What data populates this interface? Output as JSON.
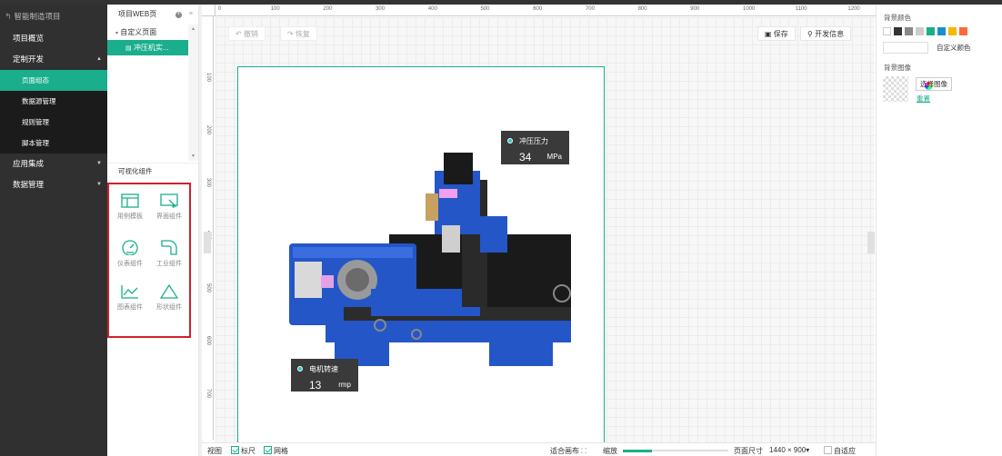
{
  "sidebar": {
    "project_title": "智能制造项目",
    "items": [
      {
        "label": "项目概览"
      },
      {
        "label": "定制开发",
        "arrow": "▲"
      },
      {
        "label": "页面组态"
      },
      {
        "label": "数据源管理"
      },
      {
        "label": "规则管理"
      },
      {
        "label": "脚本管理"
      },
      {
        "label": "应用集成",
        "arrow": "▼"
      },
      {
        "label": "数据管理",
        "arrow": "▼"
      }
    ]
  },
  "tree": {
    "header": "项目WEB页",
    "nodes": [
      {
        "label": "自定义页面",
        "icon": "caret-down-icon"
      },
      {
        "label": "冲压机实..."
      }
    ],
    "components_title": "可视化组件",
    "components": [
      {
        "label": "用例模板",
        "icon": "template-icon"
      },
      {
        "label": "界面组件",
        "icon": "ui-component-icon"
      },
      {
        "label": "仪表组件",
        "icon": "gauge-icon"
      },
      {
        "label": "工业组件",
        "icon": "pipe-icon"
      },
      {
        "label": "图表组件",
        "icon": "line-chart-icon"
      },
      {
        "label": "形状组件",
        "icon": "triangle-icon"
      }
    ]
  },
  "ruler": {
    "top_ticks": [
      "0",
      "100",
      "200",
      "300",
      "400",
      "500",
      "600",
      "700",
      "800",
      "900",
      "1000",
      "1100",
      "1200"
    ],
    "left_ticks": [
      "100",
      "200",
      "300",
      "400",
      "500",
      "600",
      "700"
    ]
  },
  "toolbar": {
    "undo": "撤销",
    "redo": "恢复",
    "save": "保存",
    "dev_info": "开发信息"
  },
  "tags": [
    {
      "label": "冲压压力",
      "value": "34",
      "unit": "MPa"
    },
    {
      "label": "电机转速",
      "value": "13",
      "unit": "rmp"
    }
  ],
  "bottombar": {
    "view": "视图",
    "ruler": "标尺",
    "grid": "网格",
    "fit_canvas": "适合画布",
    "zoom": "缩放",
    "zoom_fraction": 0.28,
    "page_size_label": "页面尺寸",
    "page_size_value": "1440 × 900▾",
    "auto_fit": "自适应"
  },
  "rpanel": {
    "bg_color_title": "背景颜色",
    "custom_color": "自定义颜色",
    "swatches": [
      "#ffffff",
      "#333333",
      "#888888",
      "#cccccc",
      "#1aae8c",
      "#1a8fd0",
      "#f5b800",
      "#ff6a3d"
    ],
    "bg_image_title": "背景图像",
    "choose_image": "选择图像",
    "reset": "重置"
  }
}
